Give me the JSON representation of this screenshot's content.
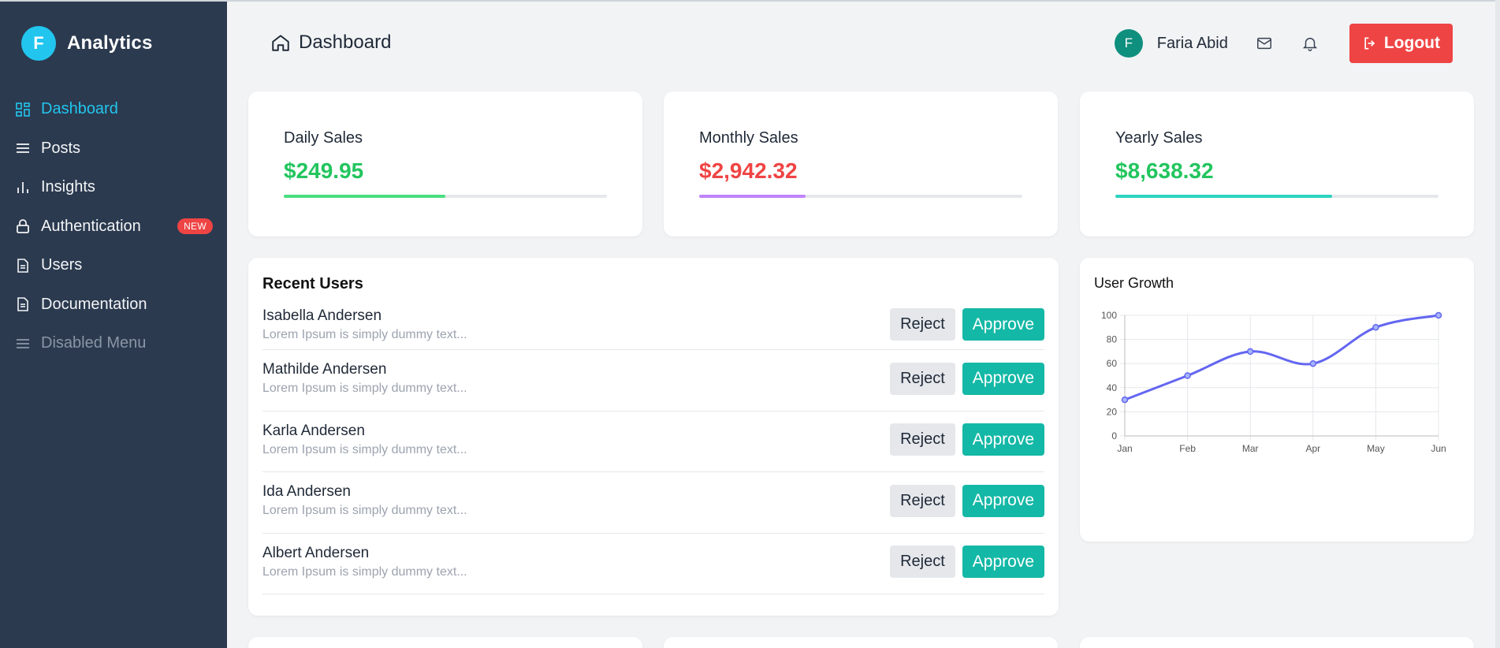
{
  "brand": {
    "logo_letter": "F",
    "name": "Analytics"
  },
  "sidebar": {
    "items": [
      {
        "label": "Dashboard",
        "icon": "grid-icon",
        "active": true
      },
      {
        "label": "Posts",
        "icon": "list-icon"
      },
      {
        "label": "Insights",
        "icon": "bar-chart-icon"
      },
      {
        "label": "Authentication",
        "icon": "lock-icon",
        "badge": "NEW"
      },
      {
        "label": "Users",
        "icon": "document-icon"
      },
      {
        "label": "Documentation",
        "icon": "document-icon"
      },
      {
        "label": "Disabled Menu",
        "icon": "list-icon",
        "disabled": true
      }
    ]
  },
  "header": {
    "title": "Dashboard",
    "user": {
      "initial": "F",
      "name": "Faria Abid"
    },
    "logout_label": "Logout"
  },
  "stats": [
    {
      "title": "Daily Sales",
      "value": "$249.95",
      "progress": 0.5,
      "value_color": "#22c55e",
      "bar_color": "#4ade80"
    },
    {
      "title": "Monthly Sales",
      "value": "$2,942.32",
      "progress": 0.33,
      "value_color": "#ef4444",
      "bar_color": "#c084fc"
    },
    {
      "title": "Yearly Sales",
      "value": "$8,638.32",
      "progress": 0.67,
      "value_color": "#22c55e",
      "bar_color": "#2dd4bf"
    }
  ],
  "recent_users": {
    "title": "Recent Users",
    "reject_label": "Reject",
    "approve_label": "Approve",
    "users": [
      {
        "name": "Isabella Andersen",
        "desc": "Lorem Ipsum is simply dummy text..."
      },
      {
        "name": "Mathilde Andersen",
        "desc": "Lorem Ipsum is simply dummy text..."
      },
      {
        "name": "Karla Andersen",
        "desc": "Lorem Ipsum is simply dummy text..."
      },
      {
        "name": "Ida Andersen",
        "desc": "Lorem Ipsum is simply dummy text..."
      },
      {
        "name": "Albert Andersen",
        "desc": "Lorem Ipsum is simply dummy text..."
      }
    ]
  },
  "user_growth": {
    "title": "User Growth"
  },
  "chart_data": {
    "type": "line",
    "title": "User Growth",
    "categories": [
      "Jan",
      "Feb",
      "Mar",
      "Apr",
      "May",
      "Jun"
    ],
    "series": [
      {
        "values": [
          30,
          50,
          70,
          60,
          90,
          100
        ]
      }
    ],
    "ylim": [
      0,
      100
    ],
    "yticks": [
      0,
      20,
      40,
      60,
      80,
      100
    ],
    "grid": true,
    "line_color": "#6366f1"
  }
}
